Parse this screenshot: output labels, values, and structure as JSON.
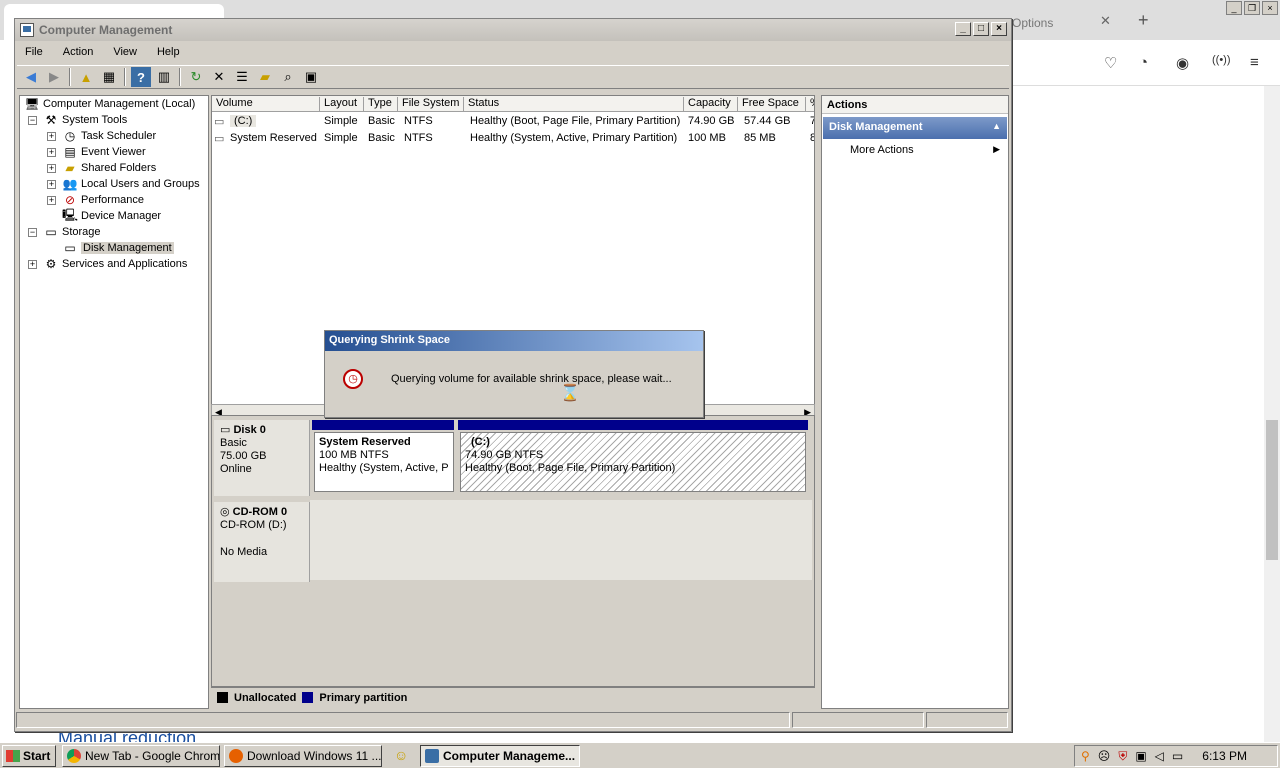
{
  "browser_bg": {
    "tab_text": "Options",
    "heading": "Manual reduction"
  },
  "window": {
    "title": "Computer Management",
    "buttons": [
      "_",
      "□",
      "×"
    ]
  },
  "menu": [
    "File",
    "Action",
    "View",
    "Help"
  ],
  "tree": {
    "root": "Computer Management (Local)",
    "system_tools": "System Tools",
    "task_scheduler": "Task Scheduler",
    "event_viewer": "Event Viewer",
    "shared_folders": "Shared Folders",
    "local_users": "Local Users and Groups",
    "performance": "Performance",
    "device_manager": "Device Manager",
    "storage": "Storage",
    "disk_management": "Disk Management",
    "services": "Services and Applications"
  },
  "volumes": {
    "headers": [
      "Volume",
      "Layout",
      "Type",
      "File System",
      "Status",
      "Capacity",
      "Free Space",
      "%"
    ],
    "rows": [
      [
        "(C:)",
        "Simple",
        "Basic",
        "NTFS",
        "Healthy (Boot, Page File, Primary Partition)",
        "74.90 GB",
        "57.44 GB",
        "7"
      ],
      [
        "System Reserved",
        "Simple",
        "Basic",
        "NTFS",
        "Healthy (System, Active, Primary Partition)",
        "100 MB",
        "85 MB",
        "8"
      ]
    ]
  },
  "disks": {
    "disk0": {
      "name": "Disk 0",
      "type": "Basic",
      "size": "75.00 GB",
      "state": "Online"
    },
    "sysres": {
      "name": "System Reserved",
      "size": "100 MB NTFS",
      "status": "Healthy (System, Active, P"
    },
    "c": {
      "name": "(C:)",
      "size": "74.90 GB NTFS",
      "status": "Healthy (Boot, Page File, Primary Partition)"
    },
    "cdrom": {
      "name": "CD-ROM 0",
      "type": "CD-ROM (D:)",
      "state": "No Media"
    }
  },
  "legend": {
    "unallocated": "Unallocated",
    "primary": "Primary partition"
  },
  "actions": {
    "header": "Actions",
    "section": "Disk Management",
    "more": "More Actions"
  },
  "dialog": {
    "title": "Querying Shrink Space",
    "message": "Querying volume for available shrink space, please wait..."
  },
  "taskbar": {
    "start": "Start",
    "tasks": [
      "New Tab - Google Chrome",
      "Download Windows 11 ...",
      "Computer Manageme..."
    ],
    "clock": "6:13 PM"
  },
  "colors": {
    "primary_partition": "#00008b",
    "unallocated": "#000000",
    "dialog_title": "#254f91",
    "actions_section": "#4b6fae"
  }
}
